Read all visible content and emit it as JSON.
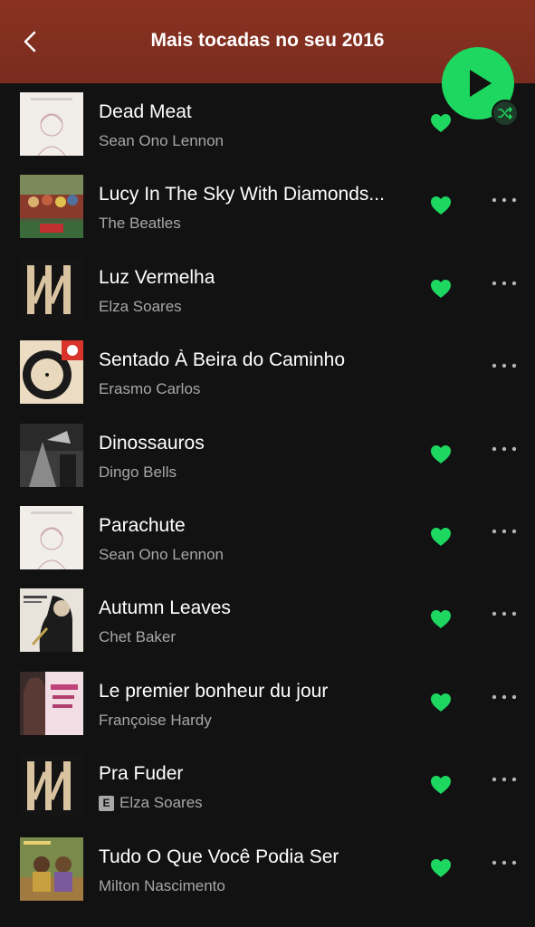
{
  "header": {
    "title": "Mais tocadas no seu 2016",
    "back_icon": "chevron-left-icon",
    "background_color": "#7e2e20"
  },
  "play_button": {
    "icon": "play-icon",
    "color": "#1ed760",
    "badge_icon": "shuffle-icon"
  },
  "accent_color": "#1ed760",
  "tracks": [
    {
      "title": "Dead Meat",
      "artist": "Sean Ono Lennon",
      "liked": true,
      "explicit": false
    },
    {
      "title": "Lucy In The Sky With Diamonds...",
      "artist": "The Beatles",
      "liked": true,
      "explicit": false
    },
    {
      "title": "Luz Vermelha",
      "artist": "Elza Soares",
      "liked": true,
      "explicit": false
    },
    {
      "title": "Sentado À Beira do Caminho",
      "artist": "Erasmo Carlos",
      "liked": false,
      "explicit": false
    },
    {
      "title": "Dinossauros",
      "artist": "Dingo Bells",
      "liked": true,
      "explicit": false
    },
    {
      "title": "Parachute",
      "artist": "Sean Ono Lennon",
      "liked": true,
      "explicit": false
    },
    {
      "title": "Autumn Leaves",
      "artist": "Chet Baker",
      "liked": true,
      "explicit": false
    },
    {
      "title": "Le premier bonheur du jour",
      "artist": "Françoise Hardy",
      "liked": true,
      "explicit": false
    },
    {
      "title": "Pra Fuder",
      "artist": "Elza Soares",
      "liked": true,
      "explicit": true,
      "explicit_label": "E"
    },
    {
      "title": "Tudo O Que Você Podia Ser",
      "artist": "Milton Nascimento",
      "liked": true,
      "explicit": false
    }
  ]
}
